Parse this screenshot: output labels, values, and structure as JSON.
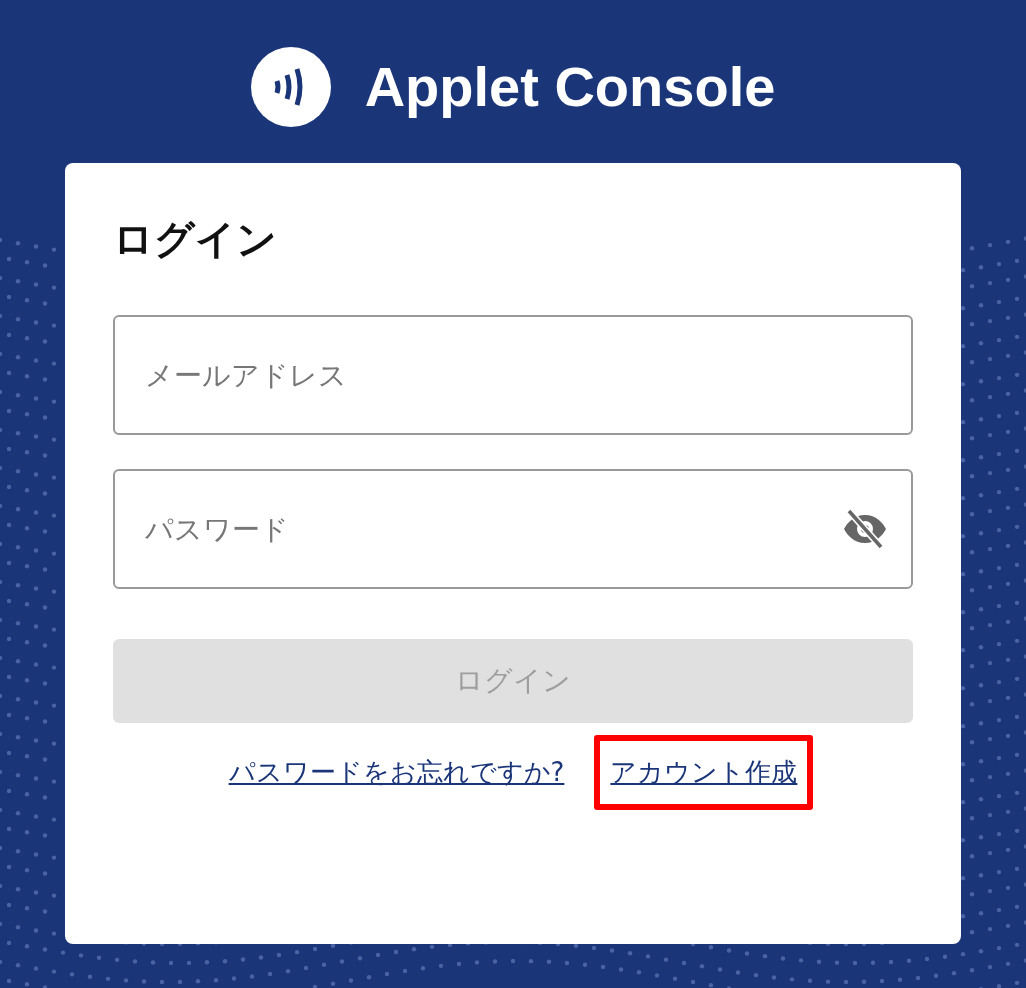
{
  "header": {
    "title": "Applet Console"
  },
  "login": {
    "heading": "ログイン",
    "fields": [
      {
        "kind": "text",
        "placeholder": "メールアドレス"
      },
      {
        "kind": "password",
        "placeholder": "パスワード",
        "password_visible": false
      }
    ],
    "submit": {
      "label": "ログイン",
      "disabled": true
    },
    "links": [
      {
        "label": "パスワードをお忘れですか?",
        "highlighted": false
      },
      {
        "label": "アカウント作成",
        "highlighted": true
      }
    ]
  }
}
